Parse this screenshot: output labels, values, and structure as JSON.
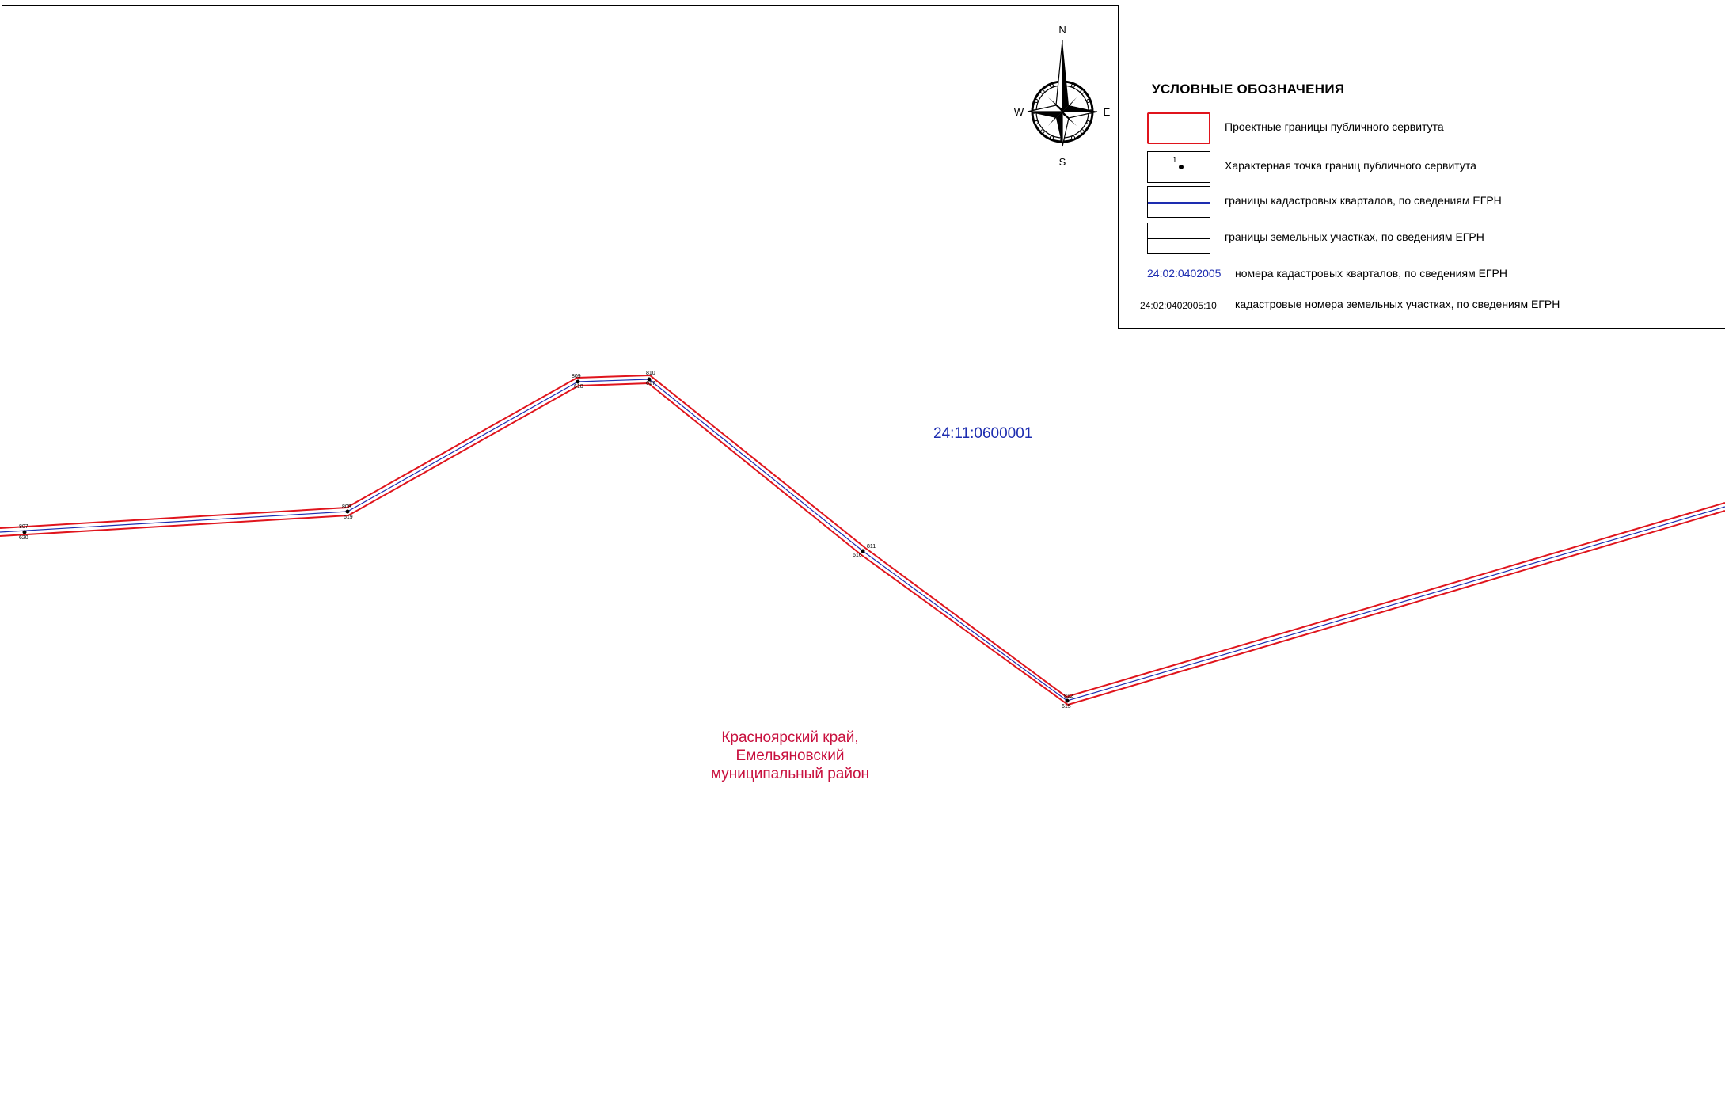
{
  "compass": {
    "north": "N",
    "south": "S",
    "east": "E",
    "west": "W"
  },
  "legend": {
    "title": "УСЛОВНЫЕ ОБОЗНАЧЕНИЯ",
    "items": [
      {
        "symbol": "red-outline",
        "label": "Проектные границы публичного сервитута"
      },
      {
        "symbol": "point",
        "sample": "1",
        "label": "Характерная точка границ публичного сервитута"
      },
      {
        "symbol": "blue-line",
        "label": "границы кадастровых кварталов, по сведениям ЕГРН"
      },
      {
        "symbol": "black-line",
        "label": "границы земельных участках, по сведениям ЕГРН"
      },
      {
        "symbol": "blue-text",
        "sample": "24:02:0402005",
        "label": "номера кадастровых кварталов, по сведениям ЕГРН"
      },
      {
        "symbol": "black-text",
        "sample": "24:02:0402005:10",
        "label": "кадастровые номера земельных участках, по сведениям ЕГРН"
      }
    ]
  },
  "map": {
    "cadastral_quarter": "24:11:0600001",
    "region_lines": [
      "Красноярский край,",
      "Емельяновский",
      "муниципальный район"
    ],
    "boundary_points": [
      {
        "upper": "807",
        "lower": "620"
      },
      {
        "upper": "808",
        "lower": "619"
      },
      {
        "upper": "809",
        "lower": "618"
      },
      {
        "upper": "810",
        "lower": "617"
      },
      {
        "upper": "811",
        "lower": "616"
      },
      {
        "upper": "812",
        "lower": "615"
      }
    ]
  },
  "colors": {
    "servitude_boundary": "#e0141c",
    "quarter_boundary": "#1d2db0",
    "quarter_text": "#1d2db0",
    "region_text": "#c8103e"
  }
}
